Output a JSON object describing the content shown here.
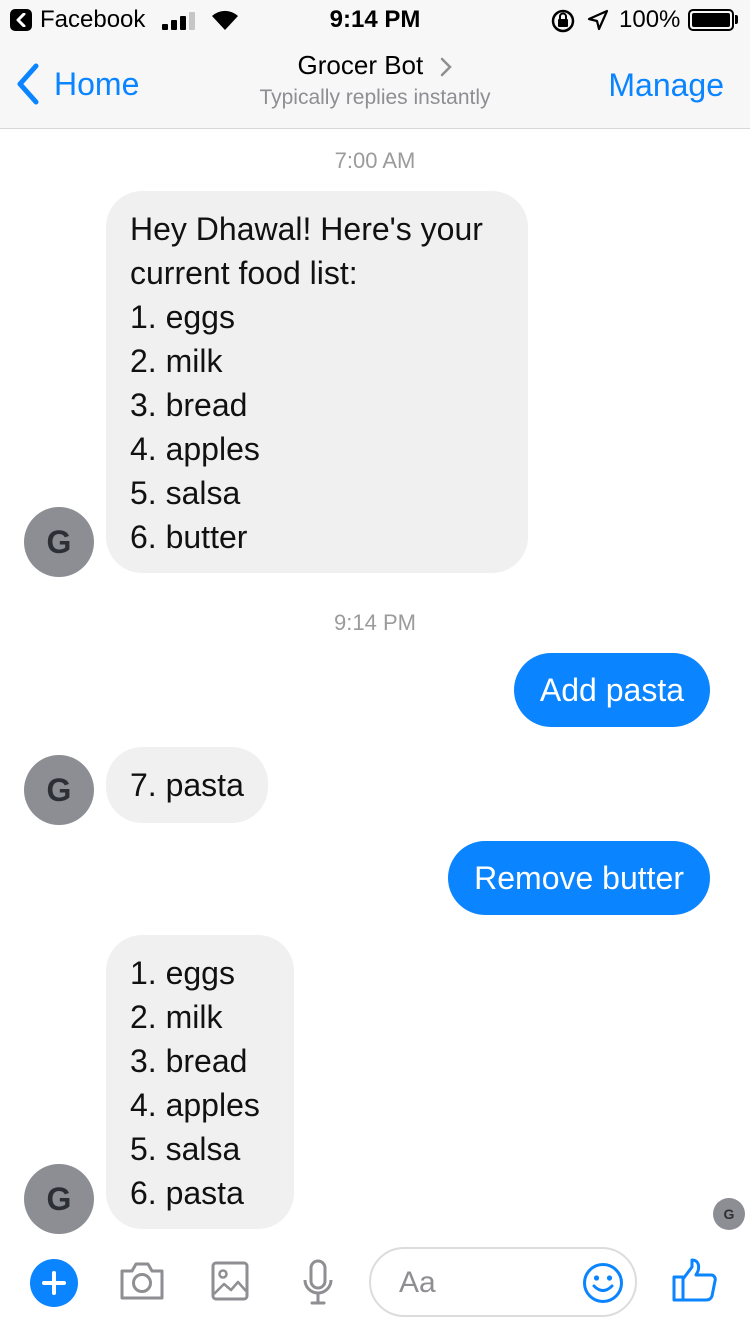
{
  "status_bar": {
    "app_name": "Facebook",
    "time": "9:14 PM",
    "battery": "100%"
  },
  "header": {
    "back_label": "Home",
    "title": "Grocer Bot",
    "subtitle": "Typically replies instantly",
    "manage_label": "Manage"
  },
  "messages": {
    "timestamp_1": "7:00 AM",
    "bot_1": {
      "lines": [
        "Hey Dhawal! Here's your",
        "current food list:",
        "1. eggs",
        "2. milk",
        "3. bread",
        "4. apples",
        "5. salsa",
        "6. butter"
      ]
    },
    "timestamp_2": "9:14 PM",
    "user_1": "Add pasta",
    "bot_2": "7. pasta",
    "user_2": "Remove butter",
    "bot_3": {
      "lines": [
        "1. eggs",
        "2. milk",
        "3. bread",
        "4. apples",
        "5. salsa",
        "6. pasta"
      ]
    },
    "avatar_letter": "G"
  },
  "composer": {
    "placeholder": "Aa"
  },
  "colors": {
    "accent": "#0a84ff",
    "incoming_bubble": "#f1f0f0",
    "avatar_bg": "#8c8e94"
  },
  "icons": [
    "back-icon",
    "signal-icon",
    "wifi-icon",
    "orientation-lock-icon",
    "location-icon",
    "battery-icon",
    "chevron-left-icon",
    "chevron-right-icon",
    "plus-icon",
    "camera-icon",
    "image-icon",
    "microphone-icon",
    "emoji-icon",
    "thumbs-up-icon"
  ]
}
